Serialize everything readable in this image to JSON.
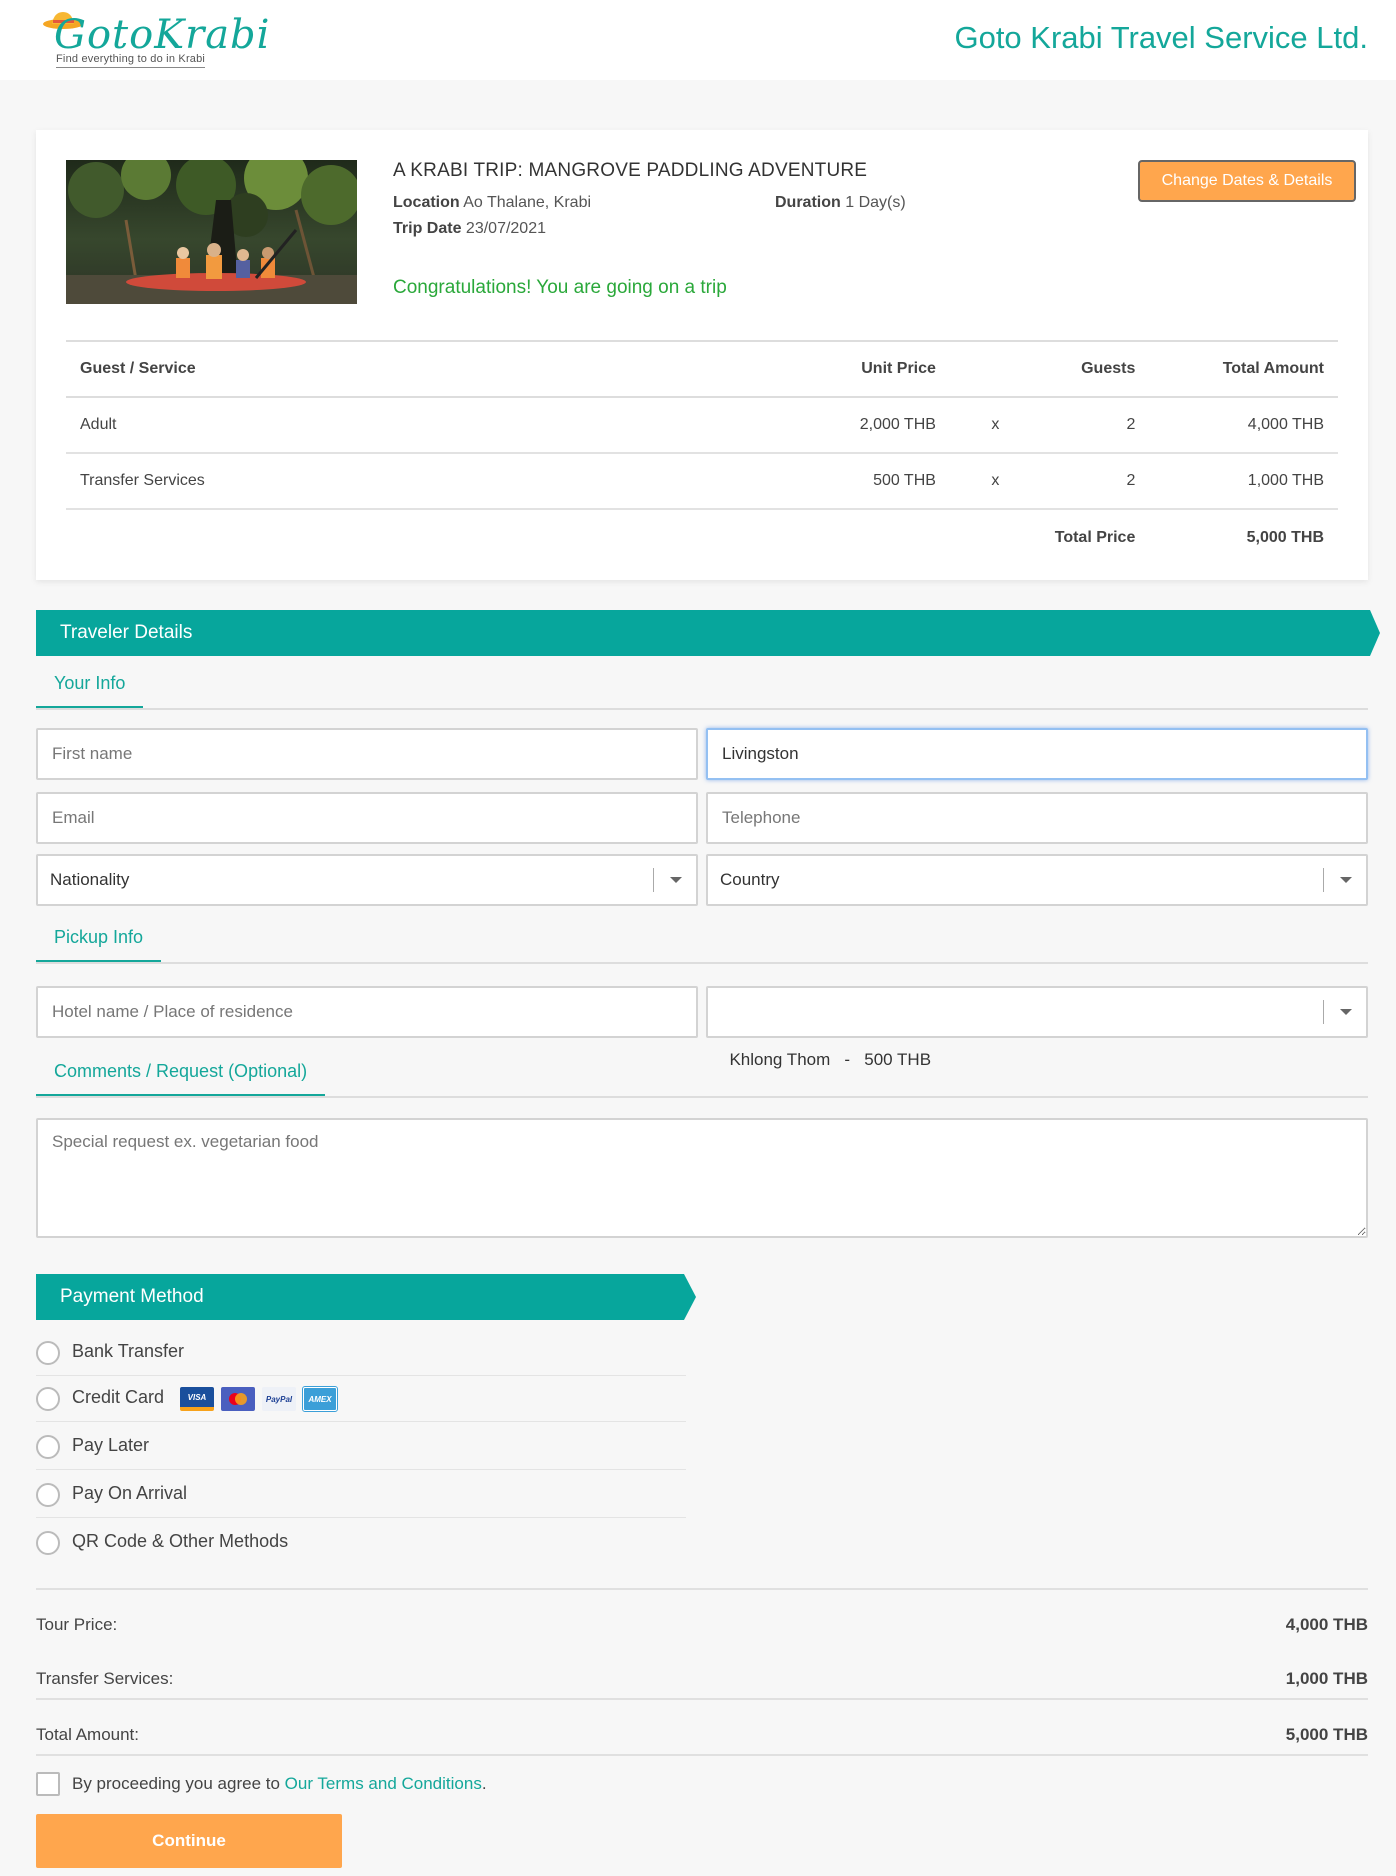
{
  "header": {
    "logo_text": "GotoKrabi",
    "logo_tagline": "Find everything to do in Krabi",
    "company": "Goto Krabi Travel Service Ltd."
  },
  "trip": {
    "title": "A KRABI TRIP: MANGROVE PADDLING ADVENTURE",
    "location_label": "Location",
    "location": "Ao Thalane, Krabi",
    "duration_label": "Duration",
    "duration": "1 Day(s)",
    "date_label": "Trip Date",
    "date": "23/07/2021",
    "congrats": "Congratulations! You are going on a trip",
    "change_button": "Change Dates & Details"
  },
  "pricing_table": {
    "headers": [
      "Guest / Service",
      "Unit Price",
      "Guests",
      "Total Amount"
    ],
    "rows": [
      {
        "name": "Adult",
        "unit": "2,000 THB",
        "x": "x",
        "guests": "2",
        "total": "4,000 THB"
      },
      {
        "name": "Transfer Services",
        "unit": "500 THB",
        "x": "x",
        "guests": "2",
        "total": "1,000 THB"
      }
    ],
    "total_label": "Total Price",
    "total_value": "5,000 THB"
  },
  "traveler": {
    "banner": "Traveler Details",
    "your_info_tab": "Your Info",
    "first_name_placeholder": "First name",
    "last_name_value": "Livingston",
    "email_placeholder": "Email",
    "telephone_placeholder": "Telephone",
    "nationality": "Nationality",
    "country": "Country",
    "pickup_tab": "Pickup Info",
    "hotel_placeholder": "Hotel name / Place of residence",
    "pickup_area": "Khlong Thom   -   500 THB",
    "comments_tab": "Comments / Request (Optional)",
    "comments_placeholder": "Special request ex. vegetarian food"
  },
  "payment": {
    "banner": "Payment Method",
    "methods": [
      "Bank Transfer",
      "Credit Card",
      "Pay Later",
      "Pay On Arrival",
      "QR Code & Other Methods"
    ],
    "card_brands": [
      "VISA",
      "Mastercard",
      "PayPal",
      "AMEX"
    ],
    "card_colors": {
      "visa": "#1a4f9c",
      "mastercard": "#4a5fbf",
      "paypal": "#eef1f7",
      "amex": "#3b9fd8"
    }
  },
  "summary": {
    "tour_label": "Tour Price:",
    "tour_value": "4,000 THB",
    "transfer_label": "Transfer Services:",
    "transfer_value": "1,000 THB",
    "total_label": "Total Amount:",
    "total_value": "5,000 THB"
  },
  "agreement": {
    "text": "By proceeding you agree to ",
    "link": "Our Terms and Conditions",
    "end": "."
  },
  "continue_button": "Continue",
  "colors": {
    "teal": "#07a69c",
    "orange": "#ffa64d",
    "green": "#2aa83a"
  }
}
